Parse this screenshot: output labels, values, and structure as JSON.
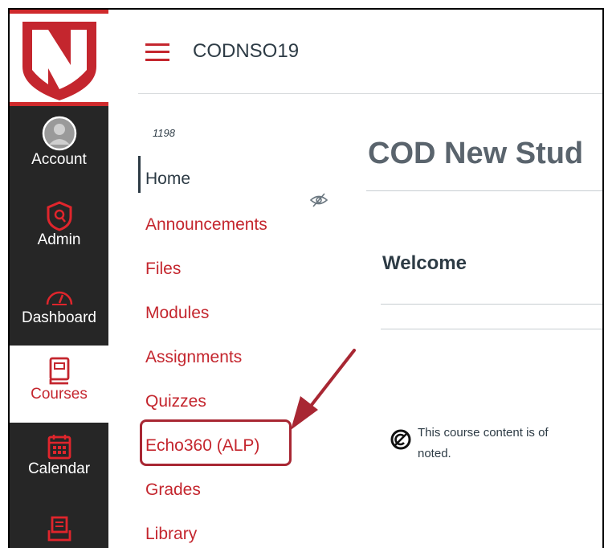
{
  "global_nav": {
    "items": [
      {
        "label": "Account",
        "icon": "avatar-icon"
      },
      {
        "label": "Admin",
        "icon": "shield-icon"
      },
      {
        "label": "Dashboard",
        "icon": "speedometer-icon"
      },
      {
        "label": "Courses",
        "icon": "book-icon",
        "active": true
      },
      {
        "label": "Calendar",
        "icon": "calendar-icon"
      },
      {
        "label": "",
        "icon": "inbox-icon"
      }
    ]
  },
  "header": {
    "course_code": "CODNSO19"
  },
  "course_nav": {
    "sub_account": "1198",
    "items": [
      {
        "label": "Home"
      },
      {
        "label": "Announcements",
        "hidden": true
      },
      {
        "label": "Files"
      },
      {
        "label": "Modules"
      },
      {
        "label": "Assignments"
      },
      {
        "label": "Quizzes"
      },
      {
        "label": "Echo360 (ALP)",
        "highlighted": true
      },
      {
        "label": "Grades"
      },
      {
        "label": "Library"
      }
    ]
  },
  "main": {
    "title": "COD New Stud",
    "welcome": "Welcome",
    "license_line1": "This course content is of",
    "license_line2": "noted."
  },
  "colors": {
    "brand_red": "#c4262e",
    "global_nav_bg": "#262626",
    "annotation": "#a82733"
  }
}
